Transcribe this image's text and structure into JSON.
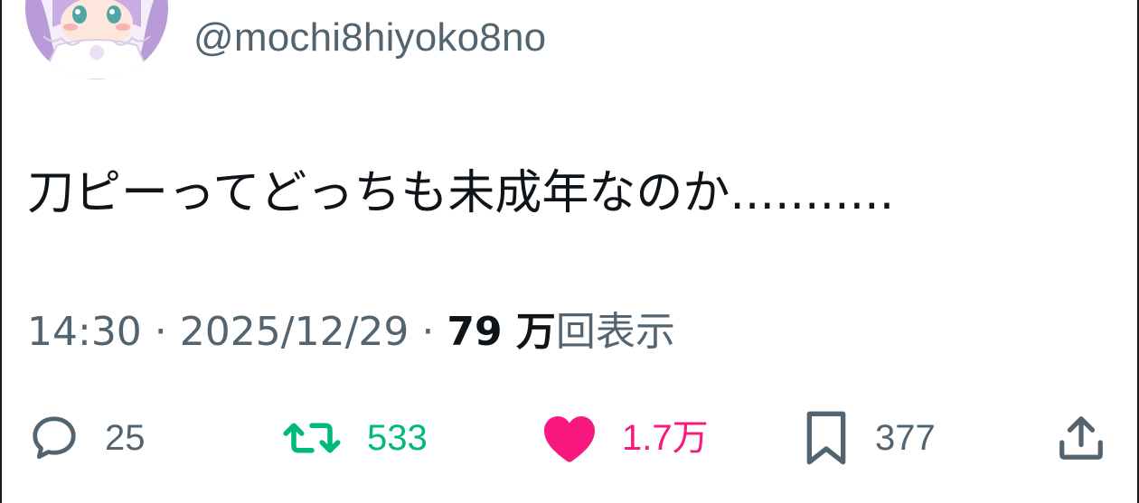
{
  "tweet": {
    "handle": "@mochi8hiyoko8no",
    "text": "刀ピーってどっちも未成年なのか...........",
    "meta": {
      "time": "14:30",
      "separator": " · ",
      "date": "2025/12/29",
      "views_count": "79 万",
      "views_label": "回表示"
    }
  },
  "actions": {
    "reply_count": "25",
    "retweet_count": "533",
    "like_count": "1.7万",
    "bookmark_count": "377"
  },
  "colors": {
    "text": "#0f1419",
    "secondary": "#536471",
    "retweet": "#00ba7c",
    "like": "#f91880"
  },
  "icons": {
    "reply": "speech-bubble-icon",
    "retweet": "retweet-arrows-icon",
    "like": "heart-icon",
    "bookmark": "bookmark-icon",
    "share": "share-upload-icon"
  }
}
